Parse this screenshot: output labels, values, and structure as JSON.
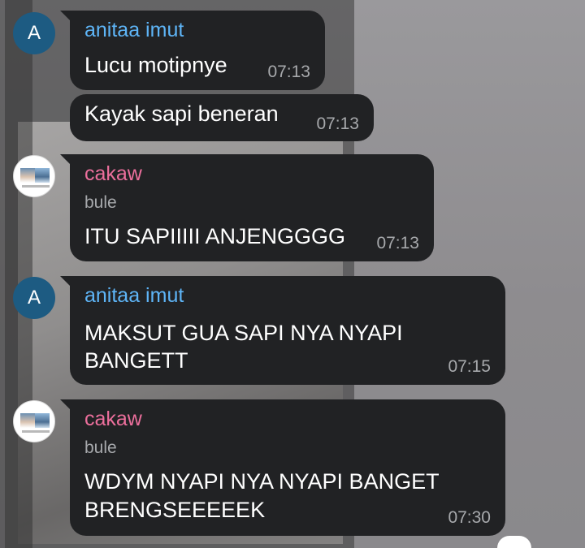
{
  "colors": {
    "sender_anitaa": "#5eb5f7",
    "sender_cakaw": "#ec6f9c",
    "bubble_bg": "#212224",
    "timestamp": "#a7a9ac",
    "avatar_letter_bg": "#1d5b82"
  },
  "messages": [
    {
      "sender": "anitaa imut",
      "avatar_letter": "A",
      "text": "Lucu motipnye",
      "time": "07:13"
    },
    {
      "text": "Kayak sapi beneran",
      "time": "07:13"
    },
    {
      "sender": "cakaw",
      "subtitle": "bule",
      "text": "ITU SAPIIIII ANJENGGGG",
      "time": "07:13"
    },
    {
      "sender": "anitaa imut",
      "avatar_letter": "A",
      "text_lines": [
        "MAKSUT GUA SAPI NYA NYAPI",
        "BANGETT"
      ],
      "time": "07:15"
    },
    {
      "sender": "cakaw",
      "subtitle": "bule",
      "text_lines": [
        "WDYM NYAPI NYA NYAPI BANGET",
        "BRENGSEEEEEK"
      ],
      "time": "07:30"
    }
  ],
  "icons": {
    "avatar_cakaw": "photo-avatar-icon",
    "scroll_button": "scroll-down-fab-icon"
  }
}
